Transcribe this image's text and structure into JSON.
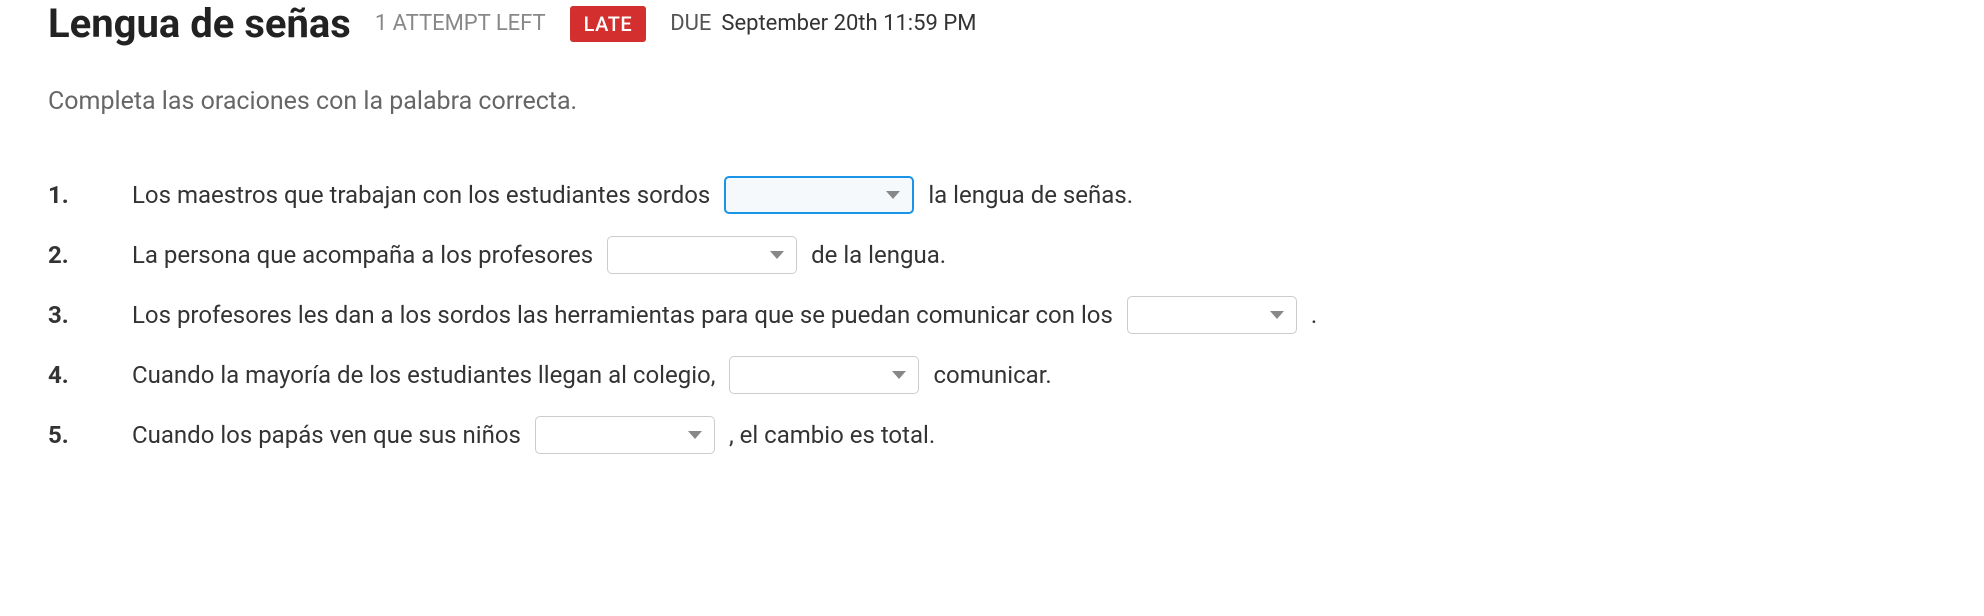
{
  "header": {
    "title": "Lengua de señas",
    "attempts": "1 ATTEMPT LEFT",
    "late_badge": "LATE",
    "due_label": "DUE",
    "due_value": "September 20th 11:59 PM"
  },
  "instructions": "Completa las oraciones con la palabra correcta.",
  "questions": [
    {
      "num": "1.",
      "before": "Los maestros que trabajan con los estudiantes sordos",
      "after": "la lengua de señas.",
      "focused": true
    },
    {
      "num": "2.",
      "before": "La persona que acompaña a los profesores",
      "after": "de la lengua.",
      "focused": false
    },
    {
      "num": "3.",
      "before": "Los profesores les dan a los sordos las herramientas para que se puedan comunicar con los",
      "after": ".",
      "focused": false
    },
    {
      "num": "4.",
      "before": "Cuando la mayoría de los estudiantes llegan al colegio,",
      "after": "comunicar.",
      "focused": false
    },
    {
      "num": "5.",
      "before": "Cuando los papás ven que sus niños",
      "after": ", el cambio es total.",
      "focused": false
    }
  ]
}
